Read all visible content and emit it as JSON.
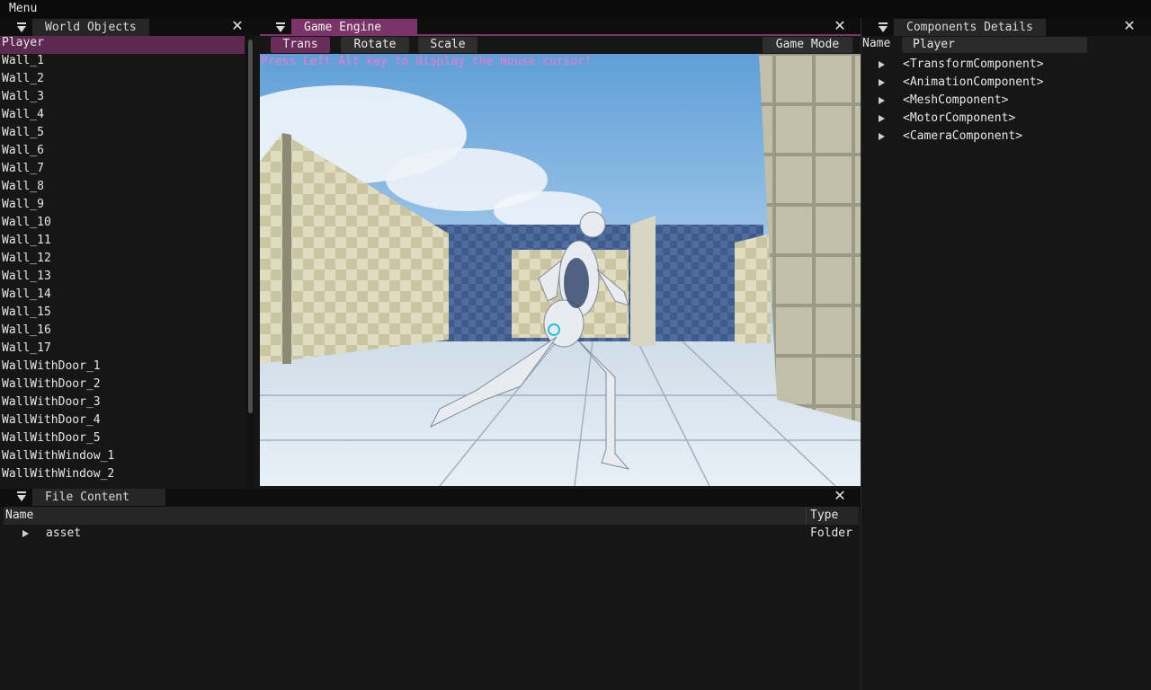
{
  "menu": {
    "label": "Menu"
  },
  "world_objects": {
    "title": "World Objects",
    "items": [
      "Player",
      "Wall_1",
      "Wall_2",
      "Wall_3",
      "Wall_4",
      "Wall_5",
      "Wall_6",
      "Wall_7",
      "Wall_8",
      "Wall_9",
      "Wall_10",
      "Wall_11",
      "Wall_12",
      "Wall_13",
      "Wall_14",
      "Wall_15",
      "Wall_16",
      "Wall_17",
      "WallWithDoor_1",
      "WallWithDoor_2",
      "WallWithDoor_3",
      "WallWithDoor_4",
      "WallWithDoor_5",
      "WallWithWindow_1",
      "WallWithWindow_2"
    ],
    "selected": "Player"
  },
  "game_engine": {
    "title": "Game Engine",
    "buttons": {
      "trans": "Trans",
      "rotate": "Rotate",
      "scale": "Scale",
      "game_mode": "Game Mode"
    },
    "active_button": "Trans",
    "hint": "Press Left Alt key to display the mouse cursor!"
  },
  "components": {
    "title": "Components Details",
    "name_label": "Name",
    "name_value": "Player",
    "items": [
      "<TransformComponent>",
      "<AnimationComponent>",
      "<MeshComponent>",
      "<MotorComponent>",
      "<CameraComponent>"
    ]
  },
  "file_content": {
    "title": "File Content",
    "columns": {
      "name": "Name",
      "type": "Type"
    },
    "rows": [
      {
        "name": "asset",
        "type": "Folder"
      }
    ]
  },
  "colors": {
    "accent_tab": "#7a3467",
    "selection": "#5e2950",
    "hint_text": "#f07ac9"
  },
  "icons": {
    "collapse": "collapse-triangle-icon",
    "close": "close-icon",
    "expand": "expand-arrow-icon"
  }
}
